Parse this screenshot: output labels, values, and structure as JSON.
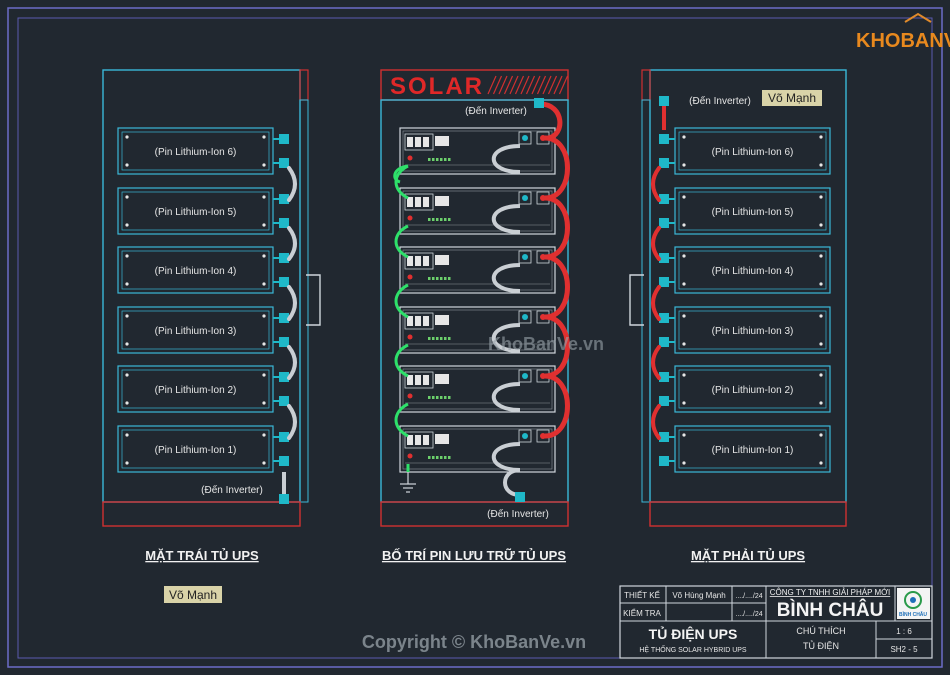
{
  "logo": {
    "text": "KHOBANVE"
  },
  "watermark": {
    "center": "KhoBanVe.vn",
    "copyright": "Copyright © KhoBanVe.vn"
  },
  "left_panel": {
    "title": "MẶT TRÁI TỦ UPS",
    "batteries": [
      "(Pin Lithium-Ion 6)",
      "(Pin Lithium-Ion 5)",
      "(Pin Lithium-Ion 4)",
      "(Pin Lithium-Ion 3)",
      "(Pin Lithium-Ion 2)",
      "(Pin Lithium-Ion 1)"
    ],
    "to_inverter": "(Đến Inverter)"
  },
  "center_panel": {
    "title": "BỐ TRÍ PIN LƯU TRỮ TỦ UPS",
    "brand": "SOLAR",
    "to_inverter_top": "(Đến Inverter)",
    "to_inverter_bottom": "(Đến Inverter)"
  },
  "right_panel": {
    "title": "MẶT PHẢI TỦ UPS",
    "batteries": [
      "(Pin Lithium-Ion 6)",
      "(Pin Lithium-Ion 5)",
      "(Pin Lithium-Ion 4)",
      "(Pin Lithium-Ion 3)",
      "(Pin Lithium-Ion 2)",
      "(Pin Lithium-Ion 1)"
    ],
    "to_inverter": "(Đến Inverter)",
    "tag": "Võ Mạnh"
  },
  "left_tag": "Võ Mạnh",
  "title_block": {
    "designer_label": "THIẾT KẾ",
    "designer_name": "Võ Hùng Mạnh",
    "designer_date": "..../..../24",
    "checker_label": "KIỂM TRA",
    "checker_date": "..../..../24",
    "company_line": "CÔNG TY TNHH GIẢI PHÁP MỚI",
    "company_name": "BÌNH CHÂU",
    "company_logo_text": "BÌNH CHÂU",
    "drawing_title": "TỦ ĐIỆN UPS",
    "drawing_subtitle": "HỆ THỐNG SOLAR HYBRID UPS",
    "note_label": "CHÚ THÍCH",
    "note_value": "TỦ ĐIỆN",
    "scale": "1 : 6",
    "sheet_no": "SH2 - 5"
  }
}
